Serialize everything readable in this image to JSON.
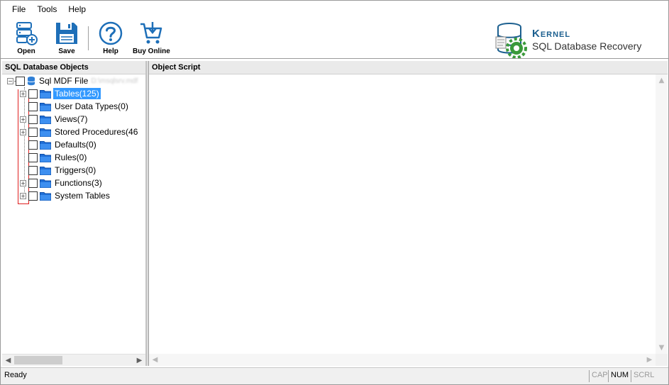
{
  "menu": [
    "File",
    "Tools",
    "Help"
  ],
  "toolbar": {
    "open": "Open",
    "save": "Save",
    "help": "Help",
    "buy": "Buy Online"
  },
  "brand": {
    "name": "Kernel",
    "product": "SQL Database Recovery"
  },
  "left_panel": {
    "title": "SQL Database Objects",
    "root_label": "Sql MDF File",
    "root_path": "D:\\msqlsrv.mdf",
    "nodes": [
      {
        "label": "Tables(125)",
        "expandable": true,
        "selected": true
      },
      {
        "label": "User Data Types(0)",
        "expandable": false
      },
      {
        "label": "Views(7)",
        "expandable": true
      },
      {
        "label": "Stored Procedures(46",
        "expandable": true
      },
      {
        "label": "Defaults(0)",
        "expandable": false
      },
      {
        "label": "Rules(0)",
        "expandable": false
      },
      {
        "label": "Triggers(0)",
        "expandable": false
      },
      {
        "label": "Functions(3)",
        "expandable": true
      },
      {
        "label": "System Tables",
        "expandable": true
      }
    ]
  },
  "right_panel": {
    "title": "Object Script"
  },
  "status": {
    "text": "Ready",
    "cap": "CAP",
    "num": "NUM",
    "scrl": "SCRL"
  },
  "colors": {
    "selection": "#3399ff",
    "brand": "#1b5f8f",
    "toolbar_icon": "#1e6fb8"
  }
}
